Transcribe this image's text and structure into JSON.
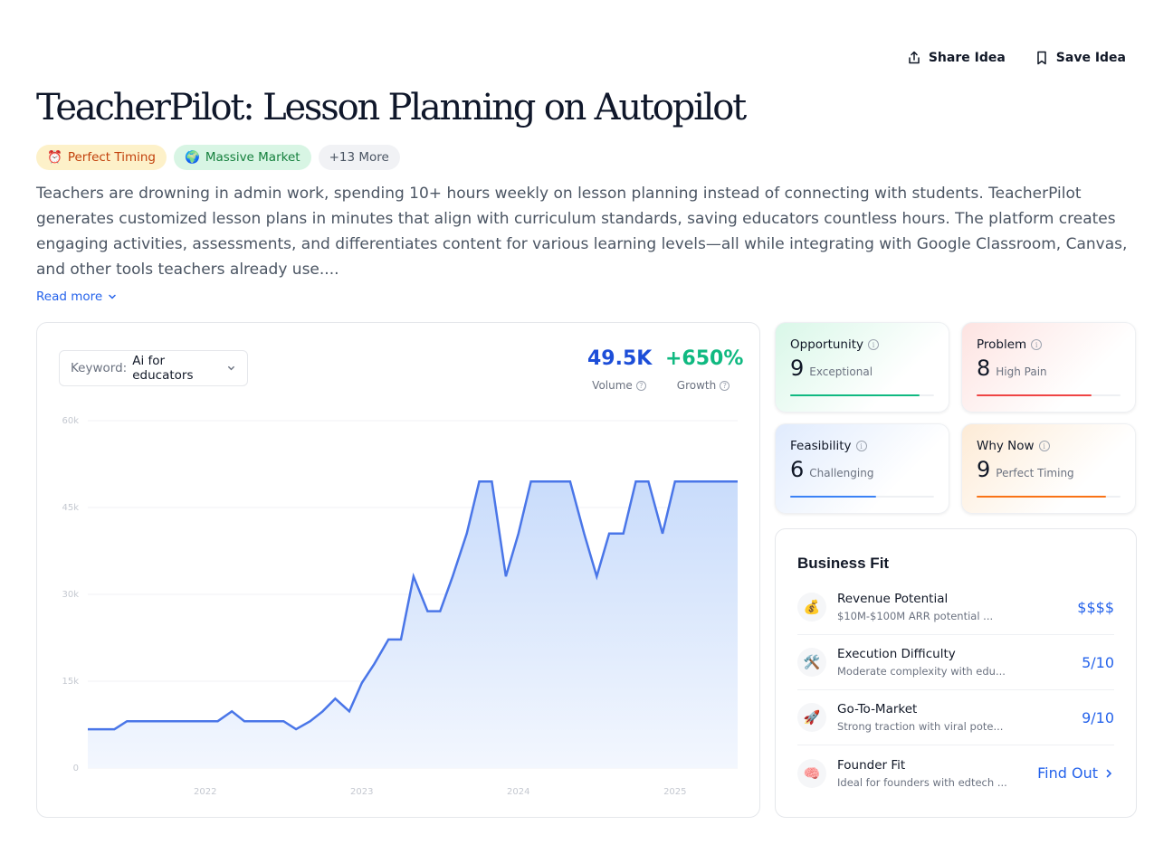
{
  "actions": {
    "share_label": "Share Idea",
    "save_label": "Save Idea"
  },
  "title": "TeacherPilot: Lesson Planning on Autopilot",
  "tags": [
    {
      "emoji": "⏰",
      "label": "Perfect Timing"
    },
    {
      "emoji": "🌍",
      "label": "Massive Market"
    },
    {
      "label": "+13 More"
    }
  ],
  "description": "Teachers are drowning in admin work, spending 10+ hours weekly on lesson planning instead of connecting with students. TeacherPilot generates customized lesson plans in minutes that align with curriculum standards, saving educators countless hours. The platform creates engaging activities, assessments, and differentiates content for various learning levels—all while integrating with Google Classroom, Canvas, and other tools teachers already use....",
  "read_more": "Read more",
  "keyword": {
    "label": "Keyword:",
    "value": "Ai for educators"
  },
  "metrics": {
    "volume": {
      "value": "49.5K",
      "label": "Volume"
    },
    "growth": {
      "value": "+650%",
      "label": "Growth"
    }
  },
  "chart_data": {
    "type": "area",
    "y_ticks": [
      "0",
      "15k",
      "30k",
      "45k",
      "60k"
    ],
    "x_ticks": [
      {
        "label": "2022",
        "year": 2022.0
      },
      {
        "label": "2023",
        "year": 2023.0
      },
      {
        "label": "2024",
        "year": 2024.0
      },
      {
        "label": "2025",
        "year": 2025.0
      }
    ],
    "ylim": [
      0,
      60000
    ],
    "xlim": [
      2021.25,
      2025.4
    ],
    "grid": true,
    "color": "#4a76e8",
    "points": [
      [
        2021.25,
        6700
      ],
      [
        2021.42,
        6700
      ],
      [
        2021.5,
        8100
      ],
      [
        2021.58,
        8100
      ],
      [
        2021.67,
        8100
      ],
      [
        2021.75,
        8100
      ],
      [
        2021.83,
        8100
      ],
      [
        2021.92,
        8100
      ],
      [
        2022.0,
        8100
      ],
      [
        2022.08,
        8100
      ],
      [
        2022.17,
        9800
      ],
      [
        2022.25,
        8100
      ],
      [
        2022.33,
        8100
      ],
      [
        2022.42,
        8100
      ],
      [
        2022.5,
        8100
      ],
      [
        2022.58,
        6700
      ],
      [
        2022.67,
        8100
      ],
      [
        2022.75,
        9800
      ],
      [
        2022.83,
        12000
      ],
      [
        2022.92,
        9800
      ],
      [
        2023.0,
        14700
      ],
      [
        2023.08,
        18000
      ],
      [
        2023.17,
        22200
      ],
      [
        2023.25,
        22200
      ],
      [
        2023.33,
        33100
      ],
      [
        2023.42,
        27100
      ],
      [
        2023.5,
        27100
      ],
      [
        2023.58,
        33100
      ],
      [
        2023.67,
        40500
      ],
      [
        2023.75,
        49500
      ],
      [
        2023.83,
        49500
      ],
      [
        2023.92,
        33100
      ],
      [
        2024.0,
        40500
      ],
      [
        2024.08,
        49500
      ],
      [
        2024.17,
        49500
      ],
      [
        2024.25,
        49500
      ],
      [
        2024.33,
        49500
      ],
      [
        2024.42,
        40500
      ],
      [
        2024.5,
        33100
      ],
      [
        2024.58,
        40500
      ],
      [
        2024.67,
        40500
      ],
      [
        2024.75,
        49500
      ],
      [
        2024.83,
        49500
      ],
      [
        2024.92,
        40500
      ],
      [
        2025.0,
        49500
      ],
      [
        2025.08,
        49500
      ],
      [
        2025.17,
        49500
      ],
      [
        2025.25,
        49500
      ],
      [
        2025.33,
        49500
      ],
      [
        2025.4,
        49500
      ]
    ]
  },
  "scores": [
    {
      "key": "opp",
      "name": "Opportunity",
      "score": "9",
      "desc": "Exceptional",
      "fill": 0.9,
      "color": "#10b981"
    },
    {
      "key": "prob",
      "name": "Problem",
      "score": "8",
      "desc": "High Pain",
      "fill": 0.8,
      "color": "#ef4444"
    },
    {
      "key": "feas",
      "name": "Feasibility",
      "score": "6",
      "desc": "Challenging",
      "fill": 0.6,
      "color": "#3b82f6"
    },
    {
      "key": "why",
      "name": "Why Now",
      "score": "9",
      "desc": "Perfect Timing",
      "fill": 0.9,
      "color": "#f97316"
    }
  ],
  "business_fit": {
    "title": "Business Fit",
    "rows": [
      {
        "icon": "💰",
        "icon_name": "money-bag-icon",
        "name": "Revenue Potential",
        "sub": "$10M-$100M ARR potential ...",
        "value": "$$$$"
      },
      {
        "icon": "🛠️",
        "icon_name": "tools-icon",
        "name": "Execution Difficulty",
        "sub": "Moderate complexity with edu...",
        "value": "5/10"
      },
      {
        "icon": "🚀",
        "icon_name": "rocket-icon",
        "name": "Go-To-Market",
        "sub": "Strong traction with viral pote...",
        "value": "9/10"
      },
      {
        "icon": "🧠",
        "icon_name": "brain-icon",
        "name": "Founder Fit",
        "sub": "Ideal for founders with edtech ...",
        "value": "Find Out"
      }
    ]
  }
}
